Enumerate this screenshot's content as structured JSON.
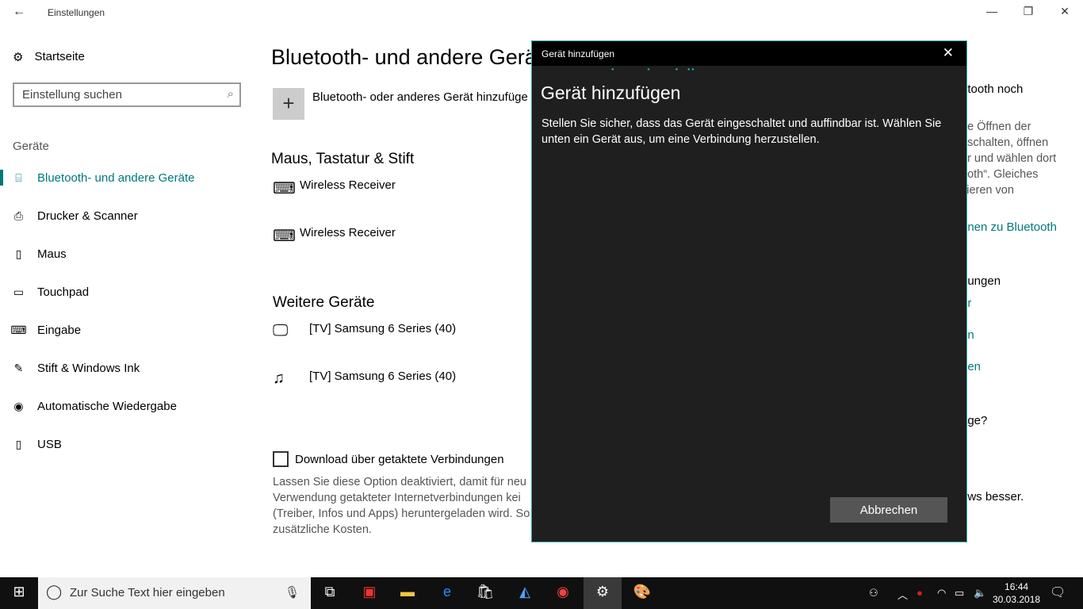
{
  "window": {
    "title": "Einstellungen",
    "back_icon": "back-arrow-icon"
  },
  "sidebar": {
    "home": "Startseite",
    "search_placeholder": "Einstellung suchen",
    "section": "Geräte",
    "items": [
      {
        "label": "Bluetooth- und andere Geräte",
        "icon": "bluetooth-devices-icon",
        "active": true
      },
      {
        "label": "Drucker & Scanner",
        "icon": "printer-icon"
      },
      {
        "label": "Maus",
        "icon": "mouse-icon"
      },
      {
        "label": "Touchpad",
        "icon": "touchpad-icon"
      },
      {
        "label": "Eingabe",
        "icon": "keyboard-icon"
      },
      {
        "label": "Stift & Windows Ink",
        "icon": "pen-icon"
      },
      {
        "label": "Automatische Wiedergabe",
        "icon": "autoplay-icon"
      },
      {
        "label": "USB",
        "icon": "usb-icon"
      }
    ]
  },
  "main": {
    "title": "Bluetooth- und andere Gerä",
    "add_label": "Bluetooth- oder anderes Gerät hinzufüge",
    "section1": "Maus, Tastatur & Stift",
    "devices1": [
      "Wireless Receiver",
      "Wireless Receiver"
    ],
    "section2": "Weitere Geräte",
    "devices2": [
      "[TV] Samsung 6 Series (40)",
      "[TV] Samsung 6 Series (40)"
    ],
    "download_label": "Download über getaktete Verbindungen",
    "download_desc": [
      "Lassen Sie diese Option deaktiviert, damit für neu",
      "Verwendung getakteter Internetverbindungen kei",
      "(Treiber, Infos und Apps) heruntergeladen wird. So",
      "zusätzliche Kosten."
    ]
  },
  "right": {
    "lines": [
      "etooth noch",
      "ne Öffnen der",
      "uschalten, öffnen",
      "er und wählen dort",
      "ooth“. Gleiches",
      "vieren von"
    ],
    "link1": "onen zu Bluetooth",
    "heading": "dungen",
    "links": [
      "er",
      "en",
      "gen"
    ],
    "q": "age?",
    "last": "ows besser."
  },
  "dialog": {
    "window_title": "Gerät hinzufügen",
    "heading": "Gerät hinzufügen",
    "text": "Stellen Sie sicher, dass das Gerät eingeschaltet und auffindbar ist. Wählen Sie unten ein Gerät aus, um eine Verbindung herzustellen.",
    "cancel": "Abbrechen"
  },
  "taskbar": {
    "search_placeholder": "Zur Suche Text hier eingeben",
    "time": "16:44",
    "date": "30.03.2018"
  },
  "colors": {
    "accent": "#00787a",
    "dialog_bg": "#1f1f1f",
    "taskbar": "#101010"
  }
}
